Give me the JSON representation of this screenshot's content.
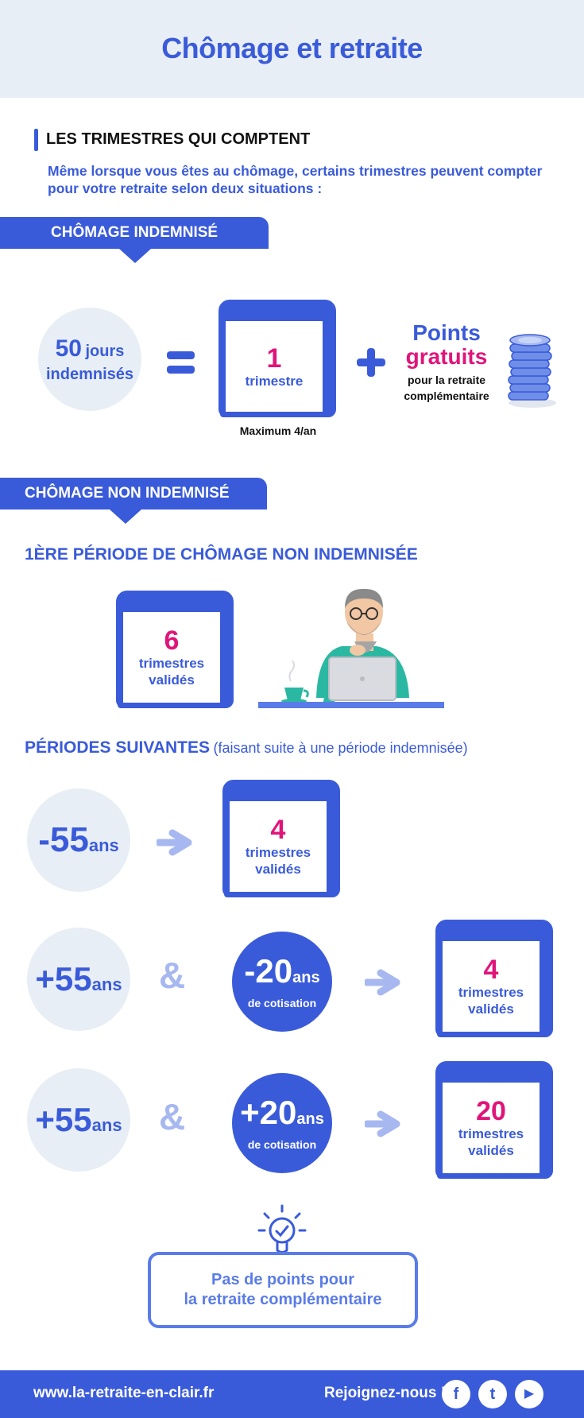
{
  "header": {
    "title": "Chômage et retraite"
  },
  "section": {
    "title": "LES TRIMESTRES QUI COMPTENT",
    "intro": "Même lorsque vous êtes au chômage, certains trimestres peuvent compter pour votre retraite selon deux situations :"
  },
  "indemnise": {
    "ribbon": "CHÔMAGE INDEMNISÉ",
    "days_num": "50",
    "days_unit": "jours",
    "days_label": "indemnisés",
    "book_num": "1",
    "book_label": "trimestre",
    "max": "Maximum 4/an",
    "points_1": "Points",
    "points_2": "gratuits",
    "points_3": "pour la retraite",
    "points_4": "complémentaire"
  },
  "non_indemnise": {
    "ribbon": "CHÔMAGE NON INDEMNISÉ",
    "first_title": "1ÈRE PÉRIODE DE CHÔMAGE NON INDEMNISÉE",
    "first_num": "6",
    "first_l1": "trimestres",
    "first_l2": "validés",
    "next_title": "PÉRIODES SUIVANTES",
    "next_sub": "(faisant suite à une période indemnisée)"
  },
  "rows": [
    {
      "age": "-55",
      "unit": "ans",
      "num": "4",
      "l1": "trimestres",
      "l2": "validés"
    },
    {
      "age": "+55",
      "unit": "ans",
      "amp": "&",
      "cot": "-20",
      "cot_unit": "ans",
      "cot_label": "de cotisation",
      "num": "4",
      "l1": "trimestres",
      "l2": "validés"
    },
    {
      "age": "+55",
      "unit": "ans",
      "amp": "&",
      "cot": "+20",
      "cot_unit": "ans",
      "cot_label": "de cotisation",
      "num": "20",
      "l1": "trimestres",
      "l2": "validés"
    }
  ],
  "note": {
    "line1": "Pas de points pour",
    "line2": "la retraite complémentaire"
  },
  "footer": {
    "site": "www.la-retraite-en-clair.fr",
    "join": "Rejoignez-nous !",
    "facebook": "f",
    "twitter": "t",
    "youtube": "▶"
  },
  "colors": {
    "primary": "#3a5bd9",
    "accent": "#e0157a",
    "light": "#e8eef5",
    "arrow": "#a7b8f0"
  },
  "icons": [
    "equals-icon",
    "plus-icon",
    "coins-icon",
    "arrow-right-icon",
    "lightbulb-icon",
    "facebook-icon",
    "twitter-icon",
    "youtube-icon"
  ]
}
